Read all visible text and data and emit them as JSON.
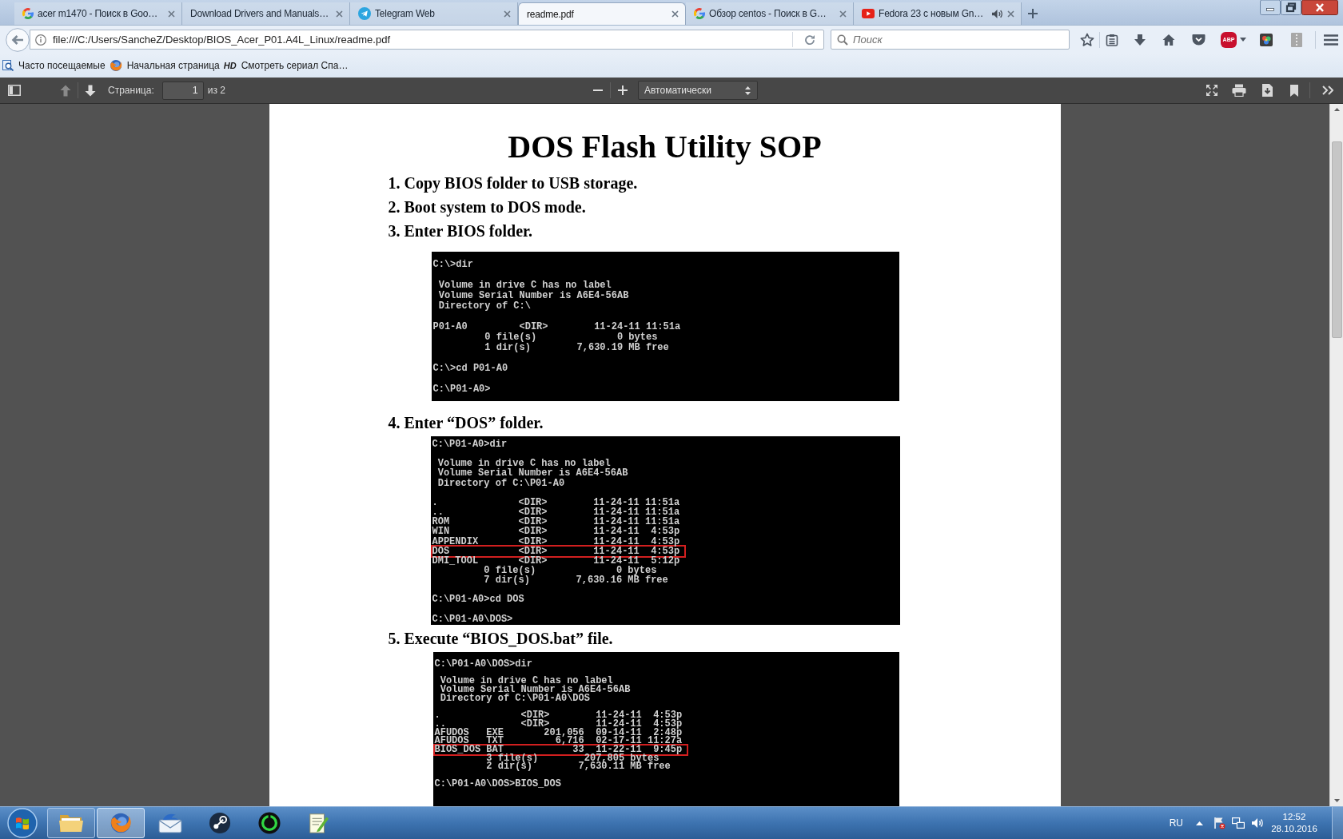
{
  "window": {
    "tabs": [
      {
        "title": "acer m1470 - Поиск в Goo…",
        "kind": "search",
        "audio": false,
        "selected": false
      },
      {
        "title": "Download Drivers and Manuals…",
        "kind": "plain",
        "audio": false,
        "selected": false
      },
      {
        "title": "Telegram Web",
        "kind": "chat",
        "audio": false,
        "selected": false
      },
      {
        "title": "readme.pdf",
        "kind": "plain",
        "audio": false,
        "selected": true
      },
      {
        "title": "Обзор centos - Поиск в G…",
        "kind": "search",
        "audio": false,
        "selected": false
      },
      {
        "title": "Fedora 23 с новым Gn…",
        "kind": "video",
        "audio": true,
        "selected": false
      }
    ]
  },
  "navigation": {
    "url": "file:///C:/Users/SancheZ/Desktop/BIOS_Acer_P01.A4L_Linux/readme.pdf",
    "search_placeholder": "Поиск",
    "extension_badge": "ABP"
  },
  "bookmarks": [
    {
      "kind": "history",
      "label": "Часто посещаемые"
    },
    {
      "kind": "browser",
      "label": "Начальная страница"
    },
    {
      "kind": "badge",
      "badge": "HD",
      "label": "Смотреть сериал Спа…"
    }
  ],
  "pdf_toolbar": {
    "previous_page": {
      "disabled": true
    },
    "next_page": {
      "disabled": false
    },
    "page_label": "Страница:",
    "page": "1",
    "page_count": "из 2",
    "zoom": "Автоматически"
  },
  "document": {
    "title": "DOS Flash Utility SOP",
    "steps": [
      {
        "text": "1. Copy BIOS folder to USB storage."
      },
      {
        "text": "2. Boot system to DOS mode."
      },
      {
        "text": "3. Enter BIOS folder.",
        "terminal": {
          "blocks": [
            [
              {
                "text": "C:\\>dir",
                "boxed": false
              }
            ],
            [
              {
                "text": " Volume in drive C has no label",
                "boxed": false
              },
              {
                "text": " Volume Serial Number is A6E4-56AB",
                "boxed": false
              },
              {
                "text": " Directory of C:\\",
                "boxed": false
              }
            ],
            [
              {
                "text": "P01-A0         <DIR>        11-24-11 11:51a",
                "boxed": false
              },
              {
                "text": "         0 file(s)              0 bytes",
                "boxed": false
              },
              {
                "text": "         1 dir(s)        7,630.19 MB free",
                "boxed": false
              }
            ],
            [
              {
                "text": "C:\\>cd P01-A0",
                "boxed": false
              }
            ],
            [
              {
                "text": "C:\\P01-A0>",
                "boxed": false
              }
            ]
          ]
        }
      },
      {
        "text": "4. Enter “DOS” folder.",
        "terminal": {
          "blocks": [
            [
              {
                "text": "C:\\P01-A0>dir",
                "boxed": false
              }
            ],
            [
              {
                "text": " Volume in drive C has no label",
                "boxed": false
              },
              {
                "text": " Volume Serial Number is A6E4-56AB",
                "boxed": false
              },
              {
                "text": " Directory of C:\\P01-A0",
                "boxed": false
              }
            ],
            [
              {
                "text": ".              <DIR>        11-24-11 11:51a",
                "boxed": false
              },
              {
                "text": "..             <DIR>        11-24-11 11:51a",
                "boxed": false
              },
              {
                "text": "ROM            <DIR>        11-24-11 11:51a",
                "boxed": false
              },
              {
                "text": "WIN            <DIR>        11-24-11  4:53p",
                "boxed": false
              },
              {
                "text": "APPENDIX       <DIR>        11-24-11  4:53p",
                "boxed": false
              },
              {
                "text": "DOS            <DIR>        11-24-11  4:53p",
                "boxed": true
              },
              {
                "text": "DMI_TOOL       <DIR>        11-24-11  5:12p",
                "boxed": false
              },
              {
                "text": "         0 file(s)              0 bytes",
                "boxed": false
              },
              {
                "text": "         7 dir(s)        7,630.16 MB free",
                "boxed": false
              }
            ],
            [
              {
                "text": "C:\\P01-A0>cd DOS",
                "boxed": false
              }
            ],
            [
              {
                "text": "C:\\P01-A0\\DOS>",
                "boxed": false
              }
            ]
          ]
        }
      },
      {
        "text": "5. Execute “BIOS_DOS.bat” file.",
        "terminal": {
          "blocks": [
            [
              {
                "text": "C:\\P01-A0\\DOS>dir",
                "boxed": false
              }
            ],
            [
              {
                "text": " Volume in drive C has no label",
                "boxed": false
              },
              {
                "text": " Volume Serial Number is A6E4-56AB",
                "boxed": false
              },
              {
                "text": " Directory of C:\\P01-A0\\DOS",
                "boxed": false
              }
            ],
            [
              {
                "text": ".              <DIR>        11-24-11  4:53p",
                "boxed": false
              },
              {
                "text": "..             <DIR>        11-24-11  4:53p",
                "boxed": false
              },
              {
                "text": "AFUDOS   EXE       201,056  09-14-11  2:48p",
                "boxed": false
              },
              {
                "text": "AFUDOS   TXT         6,716  02-17-11 11:27a",
                "boxed": false
              },
              {
                "text": "BIOS_DOS BAT            33  11-22-11  9:45p",
                "boxed": true
              },
              {
                "text": "         3 file(s)        207,805 bytes",
                "boxed": false
              },
              {
                "text": "         2 dir(s)        7,630.11 MB free",
                "boxed": false
              }
            ],
            [
              {
                "text": "C:\\P01-A0\\DOS>BIOS_DOS",
                "boxed": false
              }
            ]
          ]
        }
      }
    ]
  },
  "taskbar": {
    "apps": [
      {
        "kind": "folder",
        "running": true,
        "active": false
      },
      {
        "kind": "browser",
        "running": true,
        "active": true
      },
      {
        "kind": "mail",
        "running": false,
        "active": false
      },
      {
        "kind": "game",
        "running": false,
        "active": false
      },
      {
        "kind": "ring",
        "running": false,
        "active": false
      },
      {
        "kind": "notepad",
        "running": false,
        "active": false
      }
    ],
    "language": "RU",
    "time": "12:52",
    "date": "28.10.2016"
  }
}
